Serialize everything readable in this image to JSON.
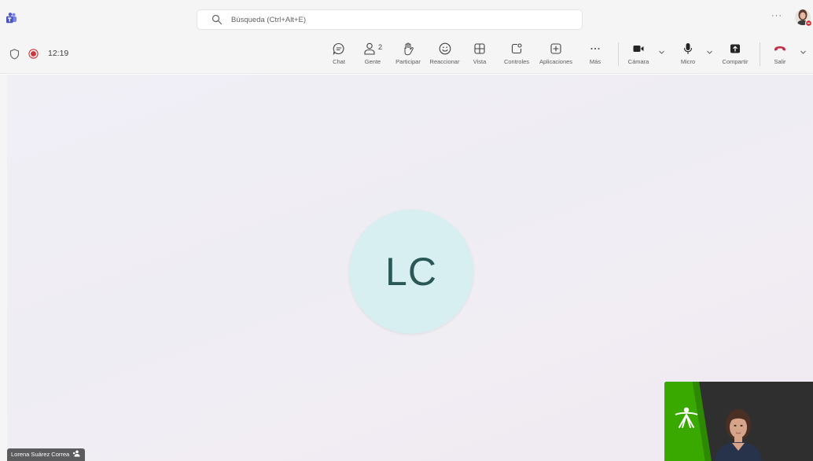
{
  "search": {
    "placeholder": "Búsqueda (Ctrl+Alt+E)"
  },
  "titlebar": {
    "more": "···"
  },
  "meeting": {
    "timer": "12:19"
  },
  "toolbar": {
    "chat": "Chat",
    "people": "Gente",
    "people_count": "2",
    "raise": "Participar",
    "react": "Reaccionar",
    "view": "Vista",
    "controls": "Controles",
    "apps": "Aplicaciones",
    "more": "Más",
    "camera": "Cámara",
    "mic": "Micro",
    "share": "Compartir",
    "leave": "Salir"
  },
  "participant": {
    "initials": "LC",
    "name": "Lorena Suárez Correa"
  },
  "colors": {
    "accent": "#5b5fc7",
    "record": "#d13438",
    "leave": "#c4314b",
    "avatar_bg": "#d7eff0",
    "avatar_text": "#2a5857",
    "sena_green": "#39a900"
  }
}
